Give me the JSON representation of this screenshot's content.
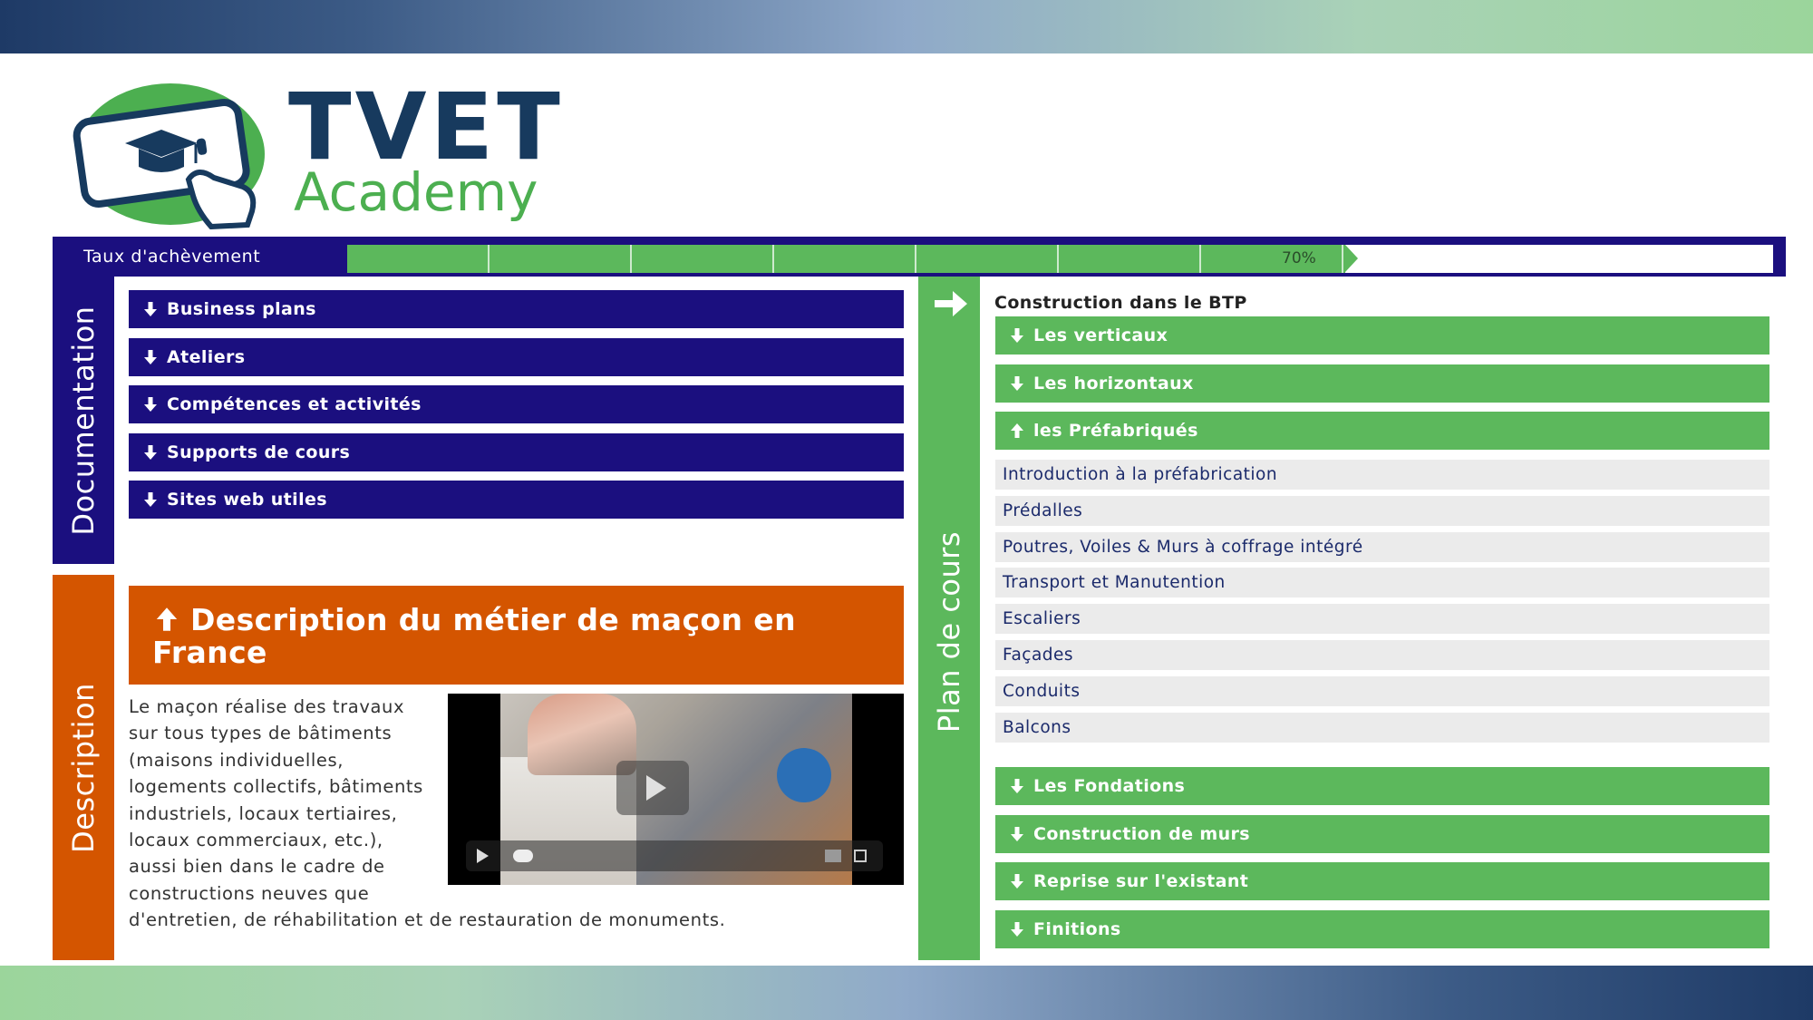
{
  "brand": {
    "line1": "TVET",
    "line2": "Academy"
  },
  "progress": {
    "label": "Taux d'achèvement",
    "value": 0.7,
    "value_text": "70%"
  },
  "documentation": {
    "tab_label": "Documentation",
    "items": [
      {
        "label": "Business plans"
      },
      {
        "label": "Ateliers"
      },
      {
        "label": "Compétences et activités"
      },
      {
        "label": "Supports de cours"
      },
      {
        "label": "Sites web utiles"
      }
    ]
  },
  "description": {
    "tab_label": "Description",
    "header": "Description du métier de maçon en France",
    "text_part1": "Le maçon réalise des travaux sur tous types de bâtiments (maisons individuelles, logements collectifs, bâtiments industriels, locaux tertiaires, locaux commerciaux, etc.), aussi bien dans le cadre de constructions neuves que",
    "text_part2": "d'entretien, de réhabilitation et de restauration de monuments."
  },
  "plan": {
    "tab_label": "Plan de cours",
    "title": "Construction dans le BTP",
    "sections_top": [
      {
        "label": "Les verticaux",
        "icon": "arrow-down-icon"
      },
      {
        "label": "Les horizontaux",
        "icon": "arrow-down-icon"
      },
      {
        "label": "les Préfabriqués",
        "icon": "arrow-up-icon"
      }
    ],
    "sub_items": [
      {
        "label": "Introduction à la préfabrication"
      },
      {
        "label": "Prédalles"
      },
      {
        "label": "Poutres, Voiles & Murs à coffrage intégré"
      },
      {
        "label": "Transport et Manutention"
      },
      {
        "label": "Escaliers"
      },
      {
        "label": "Façades"
      },
      {
        "label": "Conduits"
      },
      {
        "label": "Balcons"
      }
    ],
    "sections_bottom": [
      {
        "label": "Les Fondations",
        "icon": "arrow-down-icon"
      },
      {
        "label": "Construction de murs",
        "icon": "arrow-down-icon"
      },
      {
        "label": "Reprise sur l'existant",
        "icon": "arrow-down-icon"
      },
      {
        "label": "Finitions",
        "icon": "arrow-down-icon"
      }
    ]
  },
  "colors": {
    "navy": "#1b0f7f",
    "orange": "#d45500",
    "green": "#5cb85c",
    "logo_navy": "#173a5e"
  }
}
